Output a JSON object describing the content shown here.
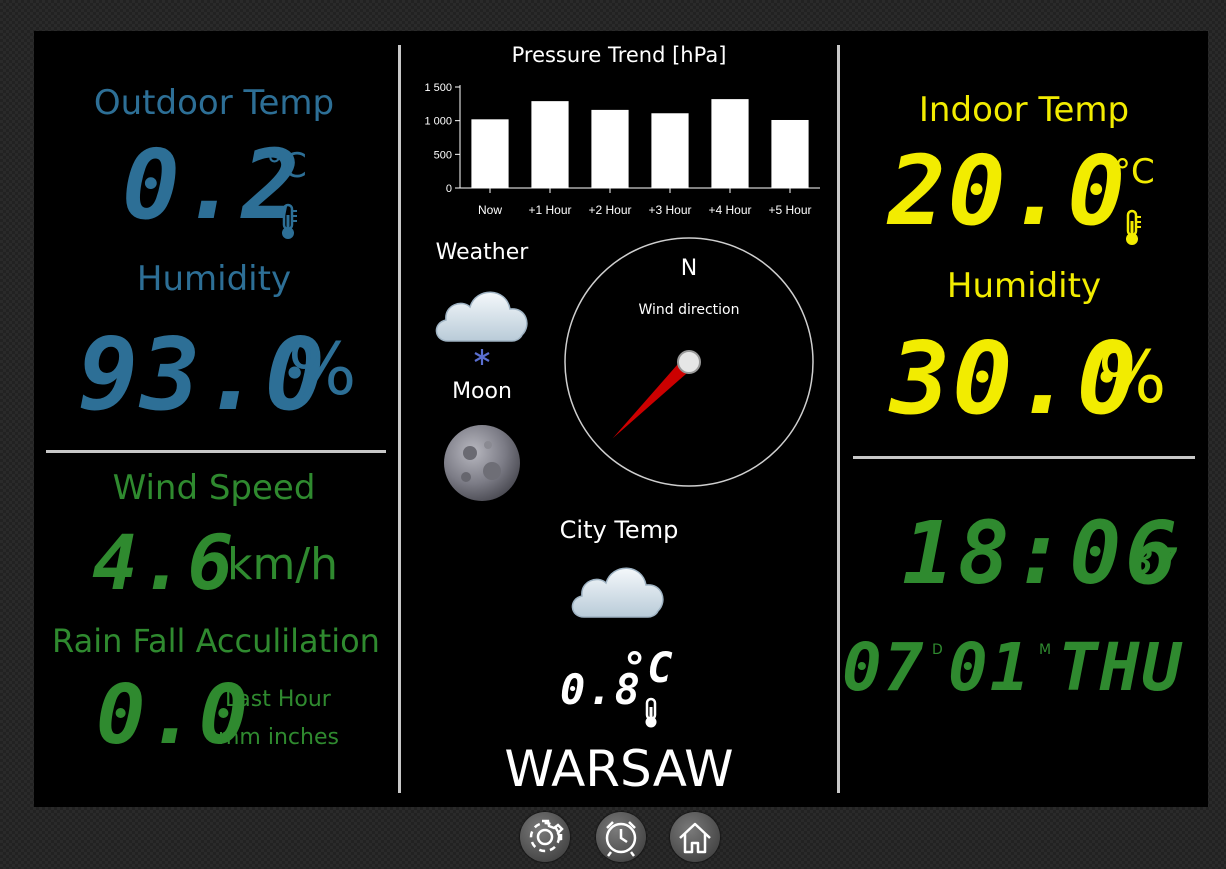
{
  "outdoor": {
    "title": "Outdoor Temp",
    "temp": "0.2",
    "temp_unit": "°C",
    "humidity_title": "Humidity",
    "humidity": "93.0",
    "humidity_unit": "%"
  },
  "wind": {
    "title": "Wind Speed",
    "speed": "4.6",
    "unit": "km/h"
  },
  "rain": {
    "title": "Rain Fall Acculilation",
    "value": "0.0",
    "period": "Last Hour",
    "units": "mm inches"
  },
  "pressure": {
    "title": "Pressure Trend [hPa]"
  },
  "weather": {
    "label": "Weather",
    "icon": "cloud-snow-icon"
  },
  "moon": {
    "label": "Moon",
    "icon": "moon-icon"
  },
  "compass": {
    "north": "N",
    "label": "Wind direction",
    "direction_deg": 225
  },
  "city": {
    "label": "City Temp",
    "temp": "0.8",
    "unit": "°C",
    "name": "WARSAW",
    "icon": "cloud-icon"
  },
  "indoor": {
    "title": "Indoor Temp",
    "temp": "20.0",
    "temp_unit": "°C",
    "humidity_title": "Humidity",
    "humidity": "30.0",
    "humidity_unit": "%"
  },
  "clock": {
    "time": "18:06",
    "seconds": "37",
    "day": "07",
    "day_marker": "D",
    "month": "01",
    "month_marker": "M",
    "weekday": "THU"
  },
  "toolbar": {
    "settings_icon": "gear-icon",
    "alarm_icon": "alarm-clock-icon",
    "home_icon": "home-icon"
  },
  "colors": {
    "outdoor": "#2d6f96",
    "indoor": "#f2ec00",
    "wind": "#2f8a2f",
    "needle": "#cc0000"
  },
  "chart_data": {
    "type": "bar",
    "title": "Pressure Trend [hPa]",
    "categories": [
      "Now",
      "+1 Hour",
      "+2 Hour",
      "+3 Hour",
      "+4 Hour",
      "+5 Hour"
    ],
    "values": [
      1020,
      1290,
      1160,
      1110,
      1320,
      1010
    ],
    "yticks": [
      "0",
      "500",
      "1 000",
      "1 500"
    ],
    "ylim": [
      0,
      1500
    ],
    "grid": false
  }
}
